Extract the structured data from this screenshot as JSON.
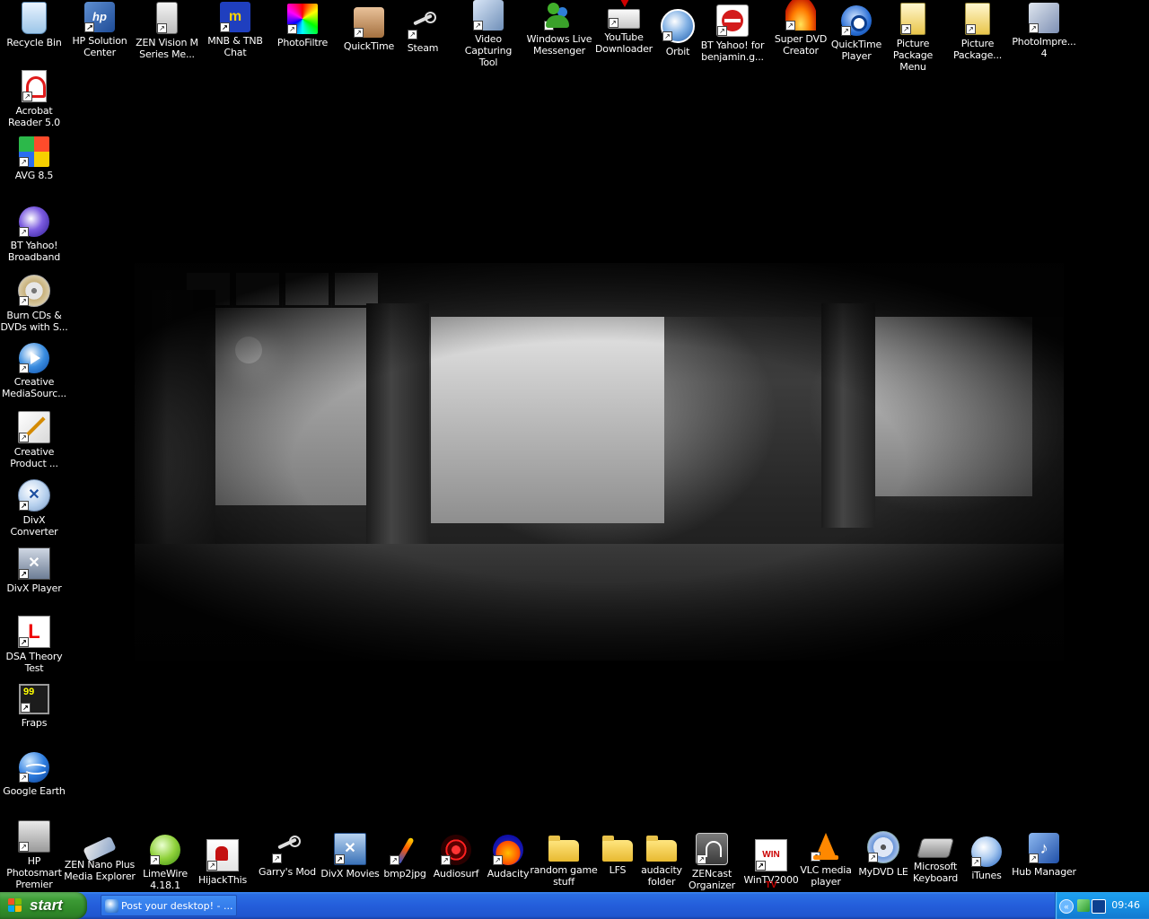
{
  "desktop": {
    "top_row": [
      {
        "label": "Recycle Bin",
        "icon": "recycle-bin-icon"
      },
      {
        "label": "HP Solution Center",
        "icon": "hp-icon"
      },
      {
        "label": "ZEN Vision M Series Me...",
        "icon": "zen-player-icon"
      },
      {
        "label": "MNB & TNB Chat",
        "icon": "chat-icon"
      },
      {
        "label": "PhotoFiltre",
        "icon": "photofiltre-icon"
      },
      {
        "label": "QuickTime",
        "icon": "box-icon"
      },
      {
        "label": "Steam",
        "icon": "steam-icon"
      },
      {
        "label": "Video Capturing Tool",
        "icon": "video-capture-icon"
      },
      {
        "label": "Windows Live Messenger",
        "icon": "messenger-icon"
      },
      {
        "label": "YouTube Downloader",
        "icon": "download-icon"
      },
      {
        "label": "Orbit",
        "icon": "orbit-download-icon"
      },
      {
        "label": "BT Yahoo! for benjamin.g...",
        "icon": "do-not-enter-icon"
      },
      {
        "label": "Super DVD Creator",
        "icon": "fire-icon"
      },
      {
        "label": "QuickTime Player",
        "icon": "quicktime-icon"
      },
      {
        "label": "Picture Package Menu",
        "icon": "picture-package-icon"
      },
      {
        "label": "Picture Package...",
        "icon": "picture-package-icon"
      },
      {
        "label": "PhotoImpre... 4",
        "icon": "photoimpression-icon"
      }
    ],
    "left_column": [
      {
        "label": "Acrobat Reader 5.0",
        "icon": "acrobat-icon"
      },
      {
        "label": "AVG 8.5",
        "icon": "avg-icon"
      },
      {
        "label": "BT Yahoo! Broadband",
        "icon": "bt-yahoo-icon"
      },
      {
        "label": "Burn CDs & DVDs with S...",
        "icon": "cd-icon"
      },
      {
        "label": "Creative MediaSourc...",
        "icon": "creative-media-icon"
      },
      {
        "label": "Creative Product ...",
        "icon": "creative-product-icon"
      },
      {
        "label": "DivX Converter",
        "icon": "divx-converter-icon"
      },
      {
        "label": "DivX Player",
        "icon": "divx-player-icon"
      },
      {
        "label": "DSA Theory Test",
        "icon": "learner-plate-icon"
      },
      {
        "label": "Fraps",
        "icon": "fraps-icon"
      },
      {
        "label": "Google Earth",
        "icon": "google-earth-icon"
      },
      {
        "label": "HP Photosmart Premier",
        "icon": "photosmart-icon"
      }
    ],
    "bottom_row": [
      {
        "label": "ZEN Nano Plus Media Explorer",
        "icon": "zen-nano-icon"
      },
      {
        "label": "LimeWire 4.18.1",
        "icon": "limewire-icon"
      },
      {
        "label": "HijackThis",
        "icon": "hijackthis-icon"
      },
      {
        "label": "Garry's Mod",
        "icon": "steam-icon"
      },
      {
        "label": "DivX Movies",
        "icon": "divx-movies-icon"
      },
      {
        "label": "bmp2jpg",
        "icon": "torch-icon"
      },
      {
        "label": "Audiosurf",
        "icon": "audiosurf-icon"
      },
      {
        "label": "Audacity",
        "icon": "audacity-icon"
      },
      {
        "label": "random game stuff",
        "icon": "folder-icon"
      },
      {
        "label": "LFS",
        "icon": "folder-icon"
      },
      {
        "label": "audacity folder",
        "icon": "folder-icon"
      },
      {
        "label": "ZENcast Organizer",
        "icon": "zencast-icon"
      },
      {
        "label": "WinTV2000",
        "icon": "wintv-icon"
      },
      {
        "label": "VLC media player",
        "icon": "vlc-cone-icon"
      },
      {
        "label": "MyDVD LE",
        "icon": "dvd-icon"
      },
      {
        "label": "Microsoft Keyboard",
        "icon": "keyboard-icon"
      },
      {
        "label": "iTunes",
        "icon": "itunes-icon"
      },
      {
        "label": "Hub Manager",
        "icon": "hub-manager-icon"
      }
    ]
  },
  "taskbar": {
    "start_label": "start",
    "task_item_label": "Post your desktop! - ...",
    "clock": "09:46"
  },
  "colors": {
    "taskbar_blue": "#245edb",
    "start_green": "#3c9a35",
    "tray_blue": "#1690e4"
  }
}
